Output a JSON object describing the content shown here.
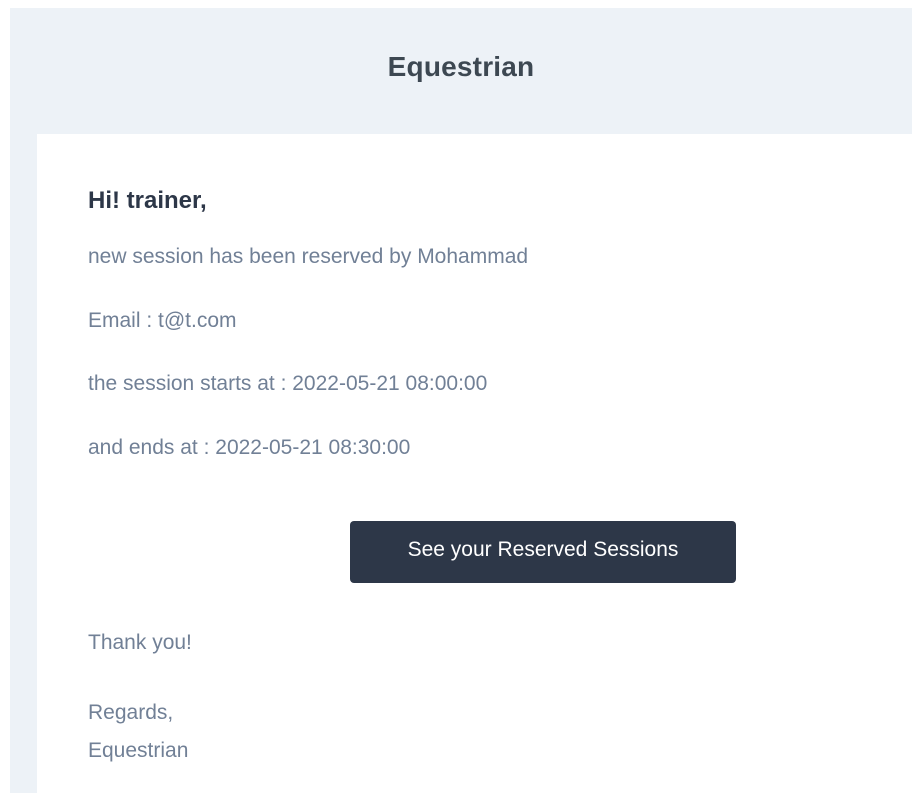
{
  "header": {
    "brand": "Equestrian"
  },
  "email": {
    "greeting": "Hi! trainer,",
    "reserved_by_line": "new session has been reserved by Mohammad",
    "email_line": "Email : t@t.com",
    "start_line": "the session starts at : 2022-05-21 08:00:00",
    "end_line": "and ends at : 2022-05-21 08:30:00",
    "action_button": "See your Reserved Sessions",
    "thanks": "Thank you!",
    "regards": "Regards,",
    "signature": "Equestrian"
  }
}
